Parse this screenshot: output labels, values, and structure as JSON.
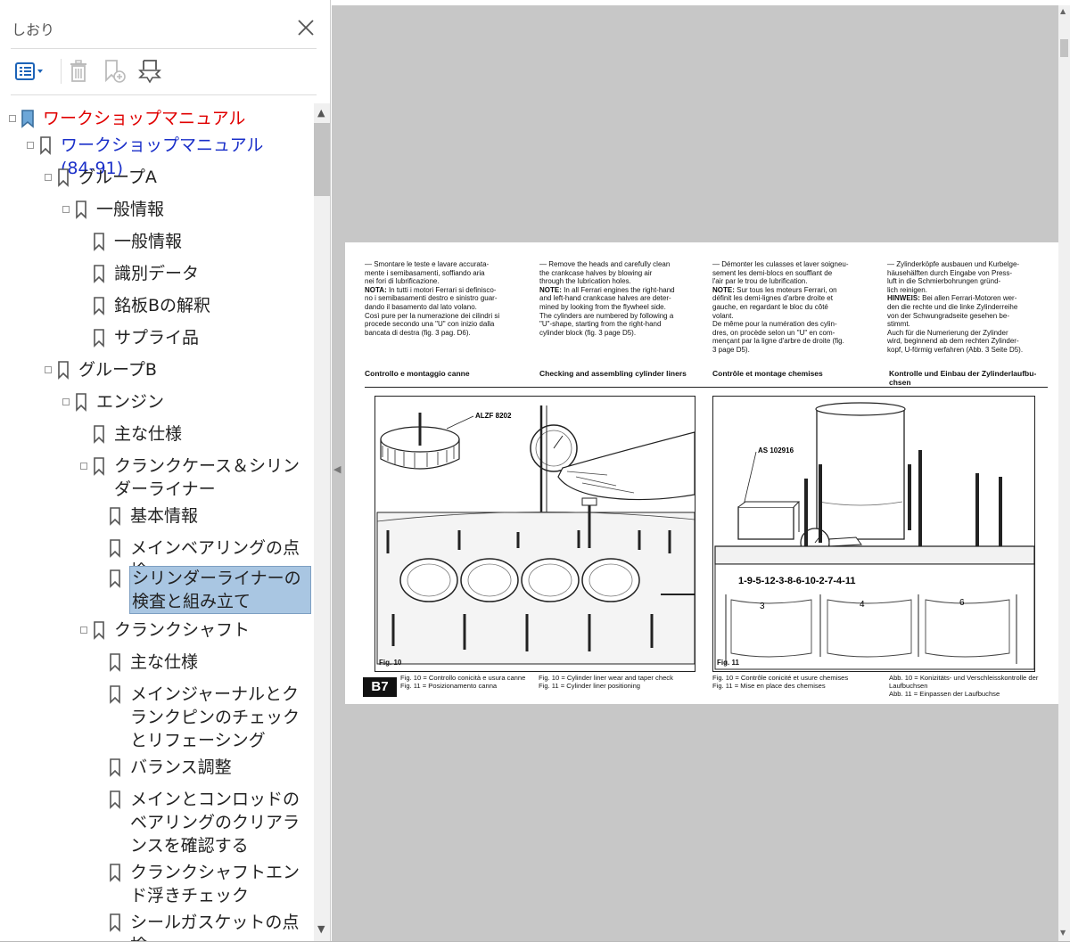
{
  "sidebar": {
    "title": "しおり",
    "close_icon": "close-icon",
    "toolbar": [
      {
        "name": "options-menu-icon"
      },
      {
        "name": "delete-bookmark-icon"
      },
      {
        "name": "add-bookmark-icon"
      },
      {
        "name": "find-bookmark-icon"
      }
    ],
    "tree": [
      {
        "label": "ワークショップマニュアル",
        "level": 0,
        "style": "red"
      },
      {
        "label": "ワークショップマニュアル (84-91)",
        "level": 1,
        "style": "blue"
      },
      {
        "label": "グループA",
        "level": 2
      },
      {
        "label": "一般情報",
        "level": 3
      },
      {
        "label": "一般情報",
        "level": 4
      },
      {
        "label": "識別データ",
        "level": 4
      },
      {
        "label": "銘板Bの解釈",
        "level": 4
      },
      {
        "label": "サプライ品",
        "level": 4
      },
      {
        "label": "グループB",
        "level": 2
      },
      {
        "label": "エンジン",
        "level": 3
      },
      {
        "label": "主な仕様",
        "level": 4
      },
      {
        "label": "クランクケース＆シリンダーライナー",
        "level": 4
      },
      {
        "label": "基本情報",
        "level": 5
      },
      {
        "label": "メインベアリングの点検",
        "level": 5
      },
      {
        "label": "シリンダーライナーの検査と組み立て",
        "level": 5,
        "selected": true
      },
      {
        "label": "クランクシャフト",
        "level": 4
      },
      {
        "label": "主な仕様",
        "level": 5
      },
      {
        "label": "メインジャーナルとクランクピンのチェックとリフェーシング",
        "level": 5
      },
      {
        "label": "バランス調整",
        "level": 5
      },
      {
        "label": "メインとコンロッドのベアリングのクリアランスを確認する",
        "level": 5
      },
      {
        "label": "クランクシャフトエンド浮きチェック",
        "level": 5
      },
      {
        "label": "シールガスケットの点検",
        "level": 5
      }
    ]
  },
  "page": {
    "columns": [
      {
        "lines": [
          "— Smontare le teste e lavare accurata-",
          "mente i semibasamenti, soffiando aria",
          "nei fori di lubrificazione.",
          "NOTA: In tutti i motori Ferrari si definisco-",
          "no i semibasamenti destro e sinistro guar-",
          "dando il basamento dal lato volano.",
          "Così pure per la numerazione dei cilindri si",
          "procede secondo una \"U\" con inizio dalla",
          "bancata di destra (fig. 3 pag. D6)."
        ]
      },
      {
        "lines": [
          "— Remove the heads and carefully clean",
          "the crankcase halves by blowing air",
          "through the lubrication holes.",
          "NOTE: In all Ferrari engines the right-hand",
          "and left-hand crankcase halves are deter-",
          "mined by looking from the flywheel side.",
          "The cylinders are numbered by following a",
          "\"U\"-shape, starting from the right-hand",
          "cylinder block (fig. 3 page D5)."
        ]
      },
      {
        "lines": [
          "— Démonter les culasses et laver soigneu-",
          "sement les demi-blocs en soufflant de",
          "l'air par le trou de lubrification.",
          "NOTE: Sur tous les moteurs Ferrari, on",
          "définit les demi-lignes d'arbre droite et",
          "gauche, en regardant le bloc du côté",
          "volant.",
          "De même pour la numération des cylin-",
          "dres, on procède selon un \"U\" en com-",
          "mençant par la ligne d'arbre de droite (fig.",
          "3 page D5)."
        ]
      },
      {
        "lines": [
          "— Zylinderköpfe ausbauen und Kurbelge-",
          "häusehälften durch Eingabe von Press-",
          "luft in die Schmierbohrungen gründ-",
          "lich reinigen.",
          "HINWEIS: Bei allen Ferrari-Motoren wer-",
          "den die rechte und die linke Zylinderreihe",
          "von der Schwungradseite gesehen be-",
          "stimmt.",
          "Auch für die Numerierung der Zylinder",
          "wird, beginnend ab dem rechten Zylinder-",
          "kopf, U-förmig verfahren (Abb. 3 Seite D5)."
        ]
      }
    ],
    "sections": [
      "Controllo e montaggio canne",
      "Checking and assembling cylinder liners",
      "Contrôle et montage chemises",
      "Kontrolle und Einbau der Zylinderlaufbu-chsen"
    ],
    "fig10": {
      "label": "Fig. 10",
      "tool": "ALZF 8202"
    },
    "fig11": {
      "label": "Fig. 11",
      "tool": "AS 102916",
      "order": "1-9-5-12-3-8-6-10-2-7-4-11",
      "nums": [
        "3",
        "4",
        "6"
      ]
    },
    "badge": "B7",
    "captions": [
      [
        "Fig. 10 = Controllo conicità e usura canne",
        "Fig. 11 = Posizionamento canna"
      ],
      [
        "Fig. 10 = Cylinder liner wear and taper check",
        "Fig. 11 = Cylinder liner positioning"
      ],
      [
        "Fig. 10 = Contrôle conicité et usure chemises",
        "Fig. 11 = Mise en place des chemises"
      ],
      [
        "Abb. 10 = Konizitäts- und Verschleisskontrolle der Laufbuchsen",
        "Abb. 11 = Einpassen der Laufbuchse"
      ]
    ]
  }
}
